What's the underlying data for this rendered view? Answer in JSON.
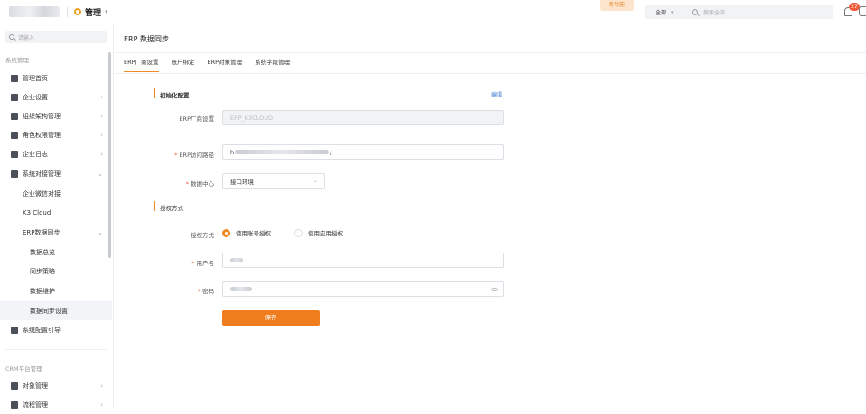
{
  "header": {
    "app_title": "管理",
    "new_feature": "新功能",
    "search_scope": "全部",
    "search_placeholder": "搜索全部",
    "notification_count": "27"
  },
  "sidebar": {
    "search_placeholder": "请输入",
    "groups": [
      {
        "title": "系统管理",
        "items": [
          {
            "label": "管理首页",
            "icon": "home-icon"
          },
          {
            "label": "企业设置",
            "icon": "building-icon",
            "has_children": true
          },
          {
            "label": "组织架构管理",
            "icon": "org-chart-icon",
            "has_children": true
          },
          {
            "label": "角色权限管理",
            "icon": "role-icon",
            "has_children": true
          },
          {
            "label": "企业日志",
            "icon": "log-icon",
            "has_children": true
          },
          {
            "label": "系统对接管理",
            "icon": "link-icon",
            "expanded": true
          }
        ]
      }
    ],
    "sub_items": [
      "企业微信对接",
      "K3 Cloud",
      "ERP数据同步"
    ],
    "sub_sub_items": [
      "数据总览",
      "同步策略",
      "数据维护",
      "数据同步设置"
    ],
    "config_guide": "系统配置引导",
    "crm_group": {
      "title": "CRM平台管理",
      "items": [
        {
          "label": "对象管理",
          "icon": "object-icon"
        },
        {
          "label": "流程管理",
          "icon": "flow-icon"
        }
      ]
    }
  },
  "main": {
    "page_title": "ERP 数据同步",
    "tabs": [
      "ERP厂商设置",
      "账户绑定",
      "ERP对象管理",
      "系统字段管理"
    ],
    "section_init": "初始化配置",
    "edit_label": "编辑",
    "fields": {
      "vendor": {
        "label": "ERP厂商设置",
        "value": "ERP_K3CLOUD"
      },
      "url": {
        "label": "ERP访问路径",
        "value_prefix": "h",
        "value_suffix": "/"
      },
      "datacenter": {
        "label": "数据中心",
        "value": "接口环境"
      }
    },
    "section_auth": "授权方式",
    "auth": {
      "label": "授权方式",
      "options": [
        "使用账号授权",
        "使用应用授权"
      ],
      "selected": "使用账号授权"
    },
    "username_label": "用户名",
    "password_label": "密码",
    "save_label": "保存"
  }
}
